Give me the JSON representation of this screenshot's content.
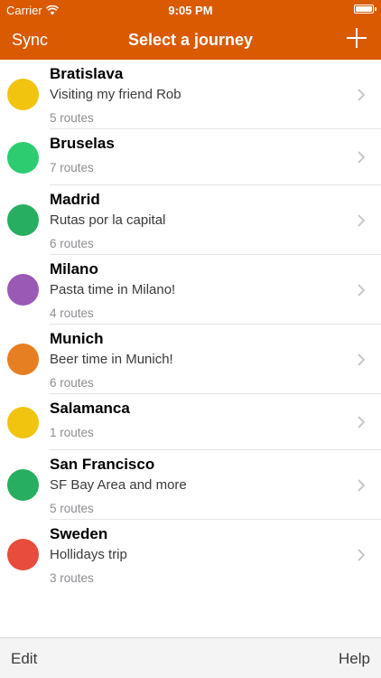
{
  "status_bar": {
    "carrier": "Carrier",
    "time": "9:05 PM"
  },
  "nav": {
    "left_label": "Sync",
    "title": "Select a journey",
    "add_icon": "plus-icon"
  },
  "colors": {
    "header": "#d95a00",
    "yellow": "#f1c40f",
    "light_green": "#2ecc71",
    "green": "#27ae60",
    "purple": "#9b59b6",
    "orange": "#e67e22",
    "red": "#e74c3c"
  },
  "journeys": [
    {
      "name": "Bratislava",
      "description": "Visiting my friend Rob",
      "routes": "5 routes",
      "color": "#f1c40f"
    },
    {
      "name": "Bruselas",
      "description": "",
      "routes": "7 routes",
      "color": "#2ecc71"
    },
    {
      "name": "Madrid",
      "description": "Rutas por la capital",
      "routes": "6 routes",
      "color": "#27ae60"
    },
    {
      "name": "Milano",
      "description": "Pasta time in Milano!",
      "routes": "4 routes",
      "color": "#9b59b6"
    },
    {
      "name": "Munich",
      "description": "Beer time in Munich!",
      "routes": "6 routes",
      "color": "#e67e22"
    },
    {
      "name": "Salamanca",
      "description": "",
      "routes": "1 routes",
      "color": "#f1c40f"
    },
    {
      "name": "San Francisco",
      "description": "SF Bay Area and more",
      "routes": "5 routes",
      "color": "#27ae60"
    },
    {
      "name": "Sweden",
      "description": "Hollidays trip",
      "routes": "3 routes",
      "color": "#e74c3c"
    }
  ],
  "toolbar": {
    "left_label": "Edit",
    "right_label": "Help"
  }
}
